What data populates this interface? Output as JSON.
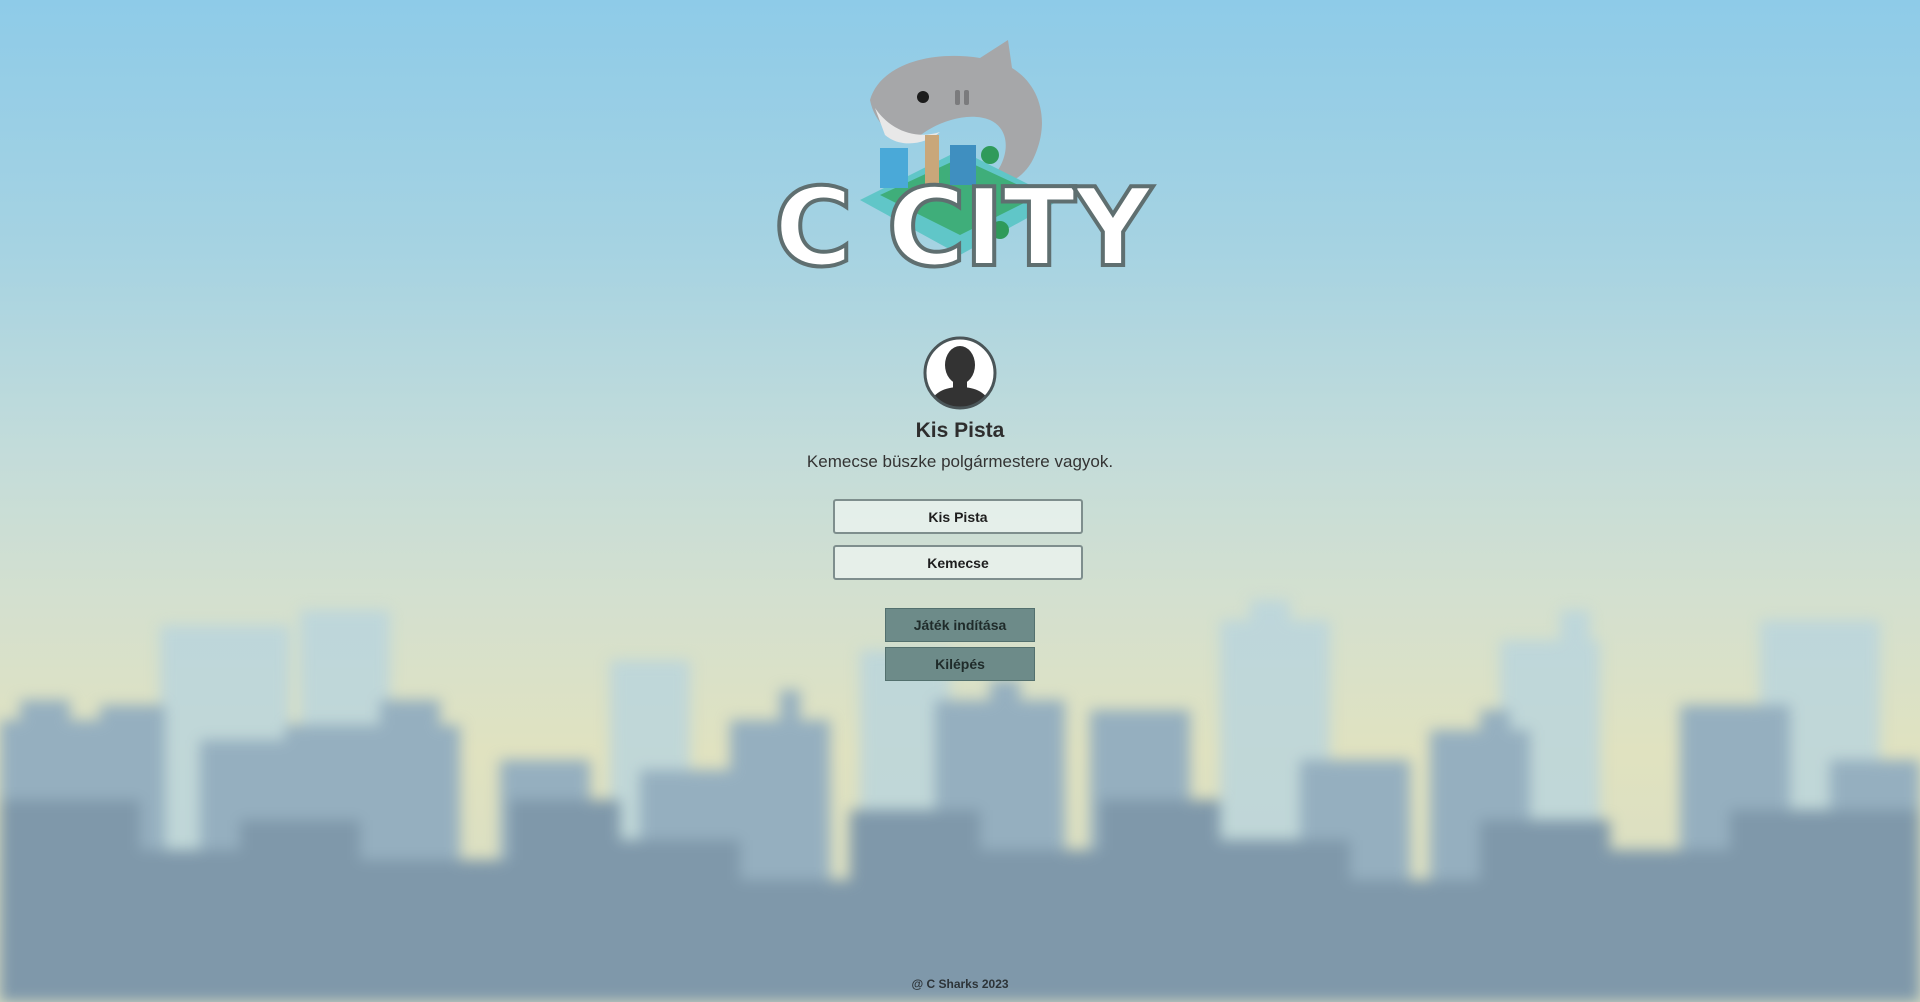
{
  "logo": {
    "text": "C CITY",
    "icon": "shark-city-logo"
  },
  "profile": {
    "avatar_icon": "user-silhouette-icon",
    "name": "Kis Pista",
    "bio": "Kemecse büszke polgármestere vagyok."
  },
  "form": {
    "player_name_value": "Kis Pista",
    "city_name_value": "Kemecse"
  },
  "buttons": {
    "start_label": "Játék indítása",
    "exit_label": "Kilépés"
  },
  "footer": {
    "text": "@ C Sharks 2023"
  },
  "colors": {
    "button_bg": "#6d8b89",
    "sky_top": "#8ecbe8",
    "skyline": "#7f98aa"
  }
}
